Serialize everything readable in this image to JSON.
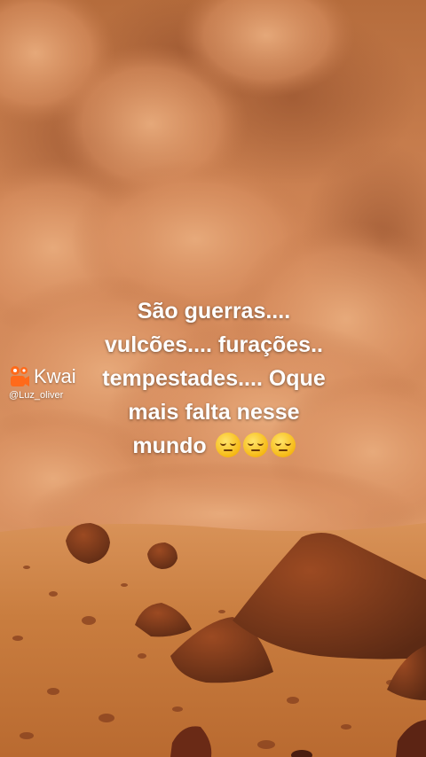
{
  "caption": {
    "line1": "São guerras....",
    "line2": "vulcões.... furações..",
    "line3": "tempestades.... Oque",
    "line4": "mais falta nesse",
    "line5": "mundo",
    "emojis": [
      "pensive-face-icon",
      "pensive-face-icon",
      "pensive-face-icon"
    ]
  },
  "watermark": {
    "brand": "Kwai",
    "handle": "@Luz_oliver",
    "logo_icon": "kwai-logo-icon",
    "logo_color": "#ff6a1a"
  },
  "colors": {
    "sky": "#c8783f",
    "dust": "#e0a070",
    "ground": "#c67a3a",
    "rock": "#7a3a1c"
  }
}
